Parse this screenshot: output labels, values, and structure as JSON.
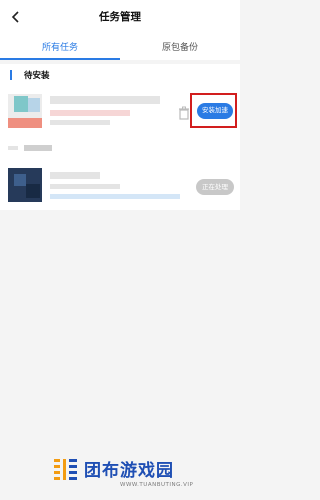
{
  "header": {
    "title": "任务管理",
    "back_icon": "back-arrow-icon"
  },
  "tabs": [
    {
      "label": "所有任务",
      "active": true
    },
    {
      "label": "原包备份",
      "active": false
    }
  ],
  "section": {
    "title": "待安装"
  },
  "tasks": [
    {
      "action_label": "安装加速",
      "trash_icon": "trash-icon"
    },
    {
      "status_label": "正在处理"
    }
  ],
  "watermark": {
    "name": "团布游戏园",
    "url": "WWW.TUANBUTING.VIP"
  },
  "colors": {
    "accent": "#2a7be4",
    "highlight": "#d21e1e",
    "disabled": "#c8c8c8",
    "watermark_blue": "#1f4fb4",
    "watermark_orange": "#f39c12"
  }
}
